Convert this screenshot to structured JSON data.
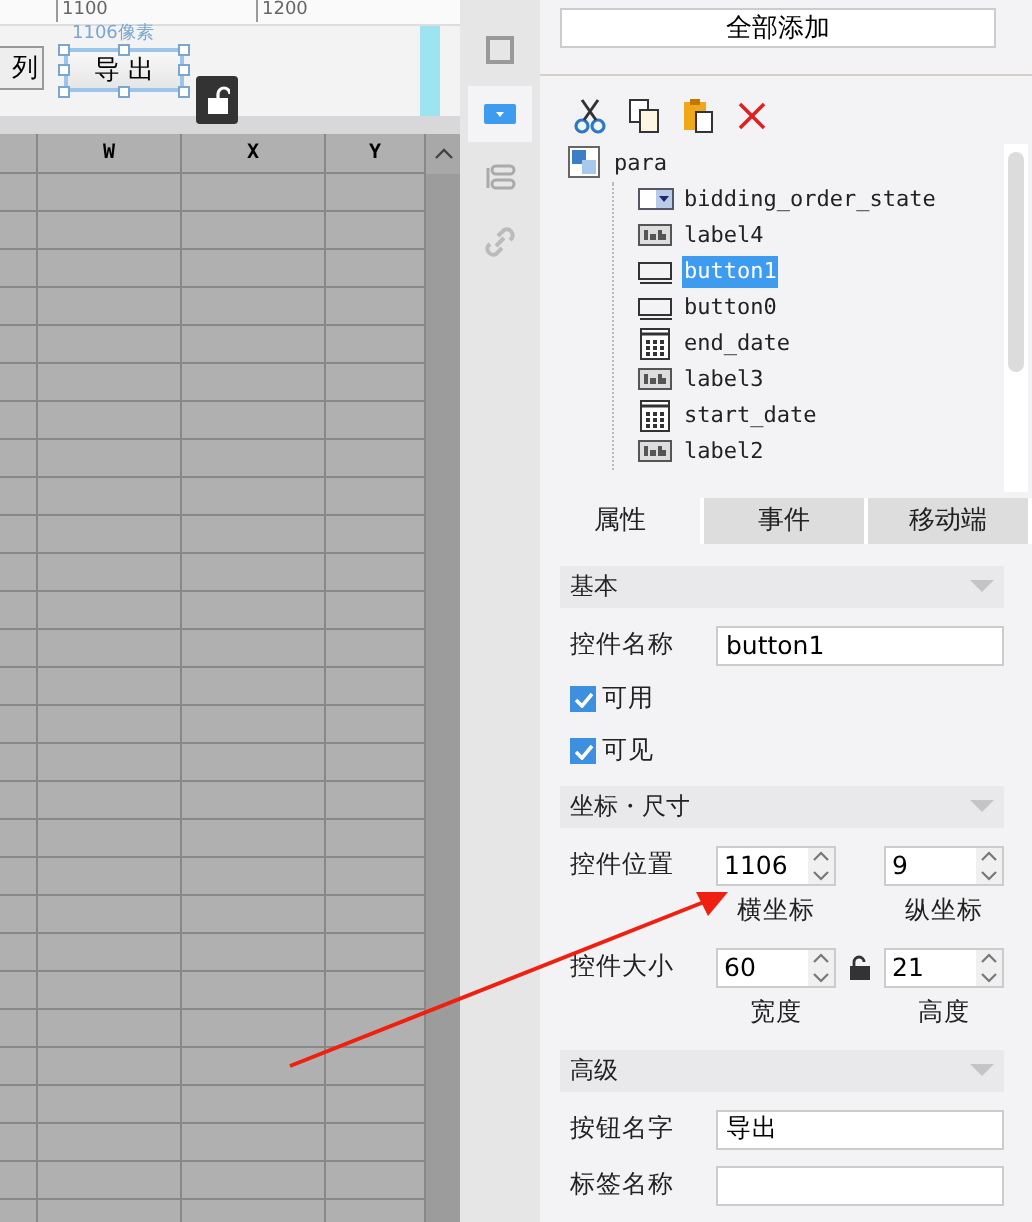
{
  "ruler": {
    "ticks": [
      "1100",
      "1200"
    ]
  },
  "canvas": {
    "partial_button": "列",
    "button": "导 出",
    "size_label": "1106像素",
    "selected": true
  },
  "sheet": {
    "columns": [
      "W",
      "X",
      "Y"
    ]
  },
  "tool_strip": [
    {
      "kind": "frame",
      "selected": false
    },
    {
      "kind": "dropdown",
      "selected": true
    },
    {
      "kind": "layout",
      "selected": false
    },
    {
      "kind": "link",
      "selected": false
    }
  ],
  "add_all_button": "全部添加",
  "toolbar": [
    {
      "kind": "cut"
    },
    {
      "kind": "copy"
    },
    {
      "kind": "paste"
    },
    {
      "kind": "delete"
    }
  ],
  "tree": {
    "label": "para",
    "kind": "container",
    "selected": false,
    "children": [
      {
        "label": "bidding_order_state",
        "kind": "dropdown",
        "selected": false
      },
      {
        "label": "label4",
        "kind": "label",
        "selected": false
      },
      {
        "label": "button1",
        "kind": "button",
        "selected": true
      },
      {
        "label": "button0",
        "kind": "button",
        "selected": false
      },
      {
        "label": "end_date",
        "kind": "date",
        "selected": false
      },
      {
        "label": "label3",
        "kind": "label",
        "selected": false
      },
      {
        "label": "start_date",
        "kind": "date",
        "selected": false
      },
      {
        "label": "label2",
        "kind": "label",
        "selected": false
      }
    ]
  },
  "tabs": [
    {
      "label": "属性",
      "selected": true
    },
    {
      "label": "事件",
      "selected": false
    },
    {
      "label": "移动端",
      "selected": false
    }
  ],
  "sections": [
    {
      "title": "基本",
      "fields": [
        {
          "kind": "text",
          "label": "控件名称",
          "value": "button1"
        },
        {
          "kind": "checkbox",
          "label": "可用",
          "checked": true
        },
        {
          "kind": "checkbox",
          "label": "可见",
          "checked": true
        }
      ]
    },
    {
      "title": "坐标・尺寸",
      "fields": [
        {
          "kind": "pair",
          "label": "控件位置",
          "lock": false,
          "first": {
            "value": "1106",
            "caption": "横坐标"
          },
          "second": {
            "value": "9",
            "caption": "纵坐标"
          }
        },
        {
          "kind": "pair",
          "label": "控件大小",
          "lock": true,
          "first": {
            "value": "60",
            "caption": "宽度"
          },
          "second": {
            "value": "21",
            "caption": "高度"
          }
        }
      ]
    },
    {
      "title": "高级",
      "fields": [
        {
          "kind": "text",
          "label": "按钮名字",
          "value": "导出"
        },
        {
          "kind": "text",
          "label": "标签名称"
        }
      ]
    }
  ]
}
